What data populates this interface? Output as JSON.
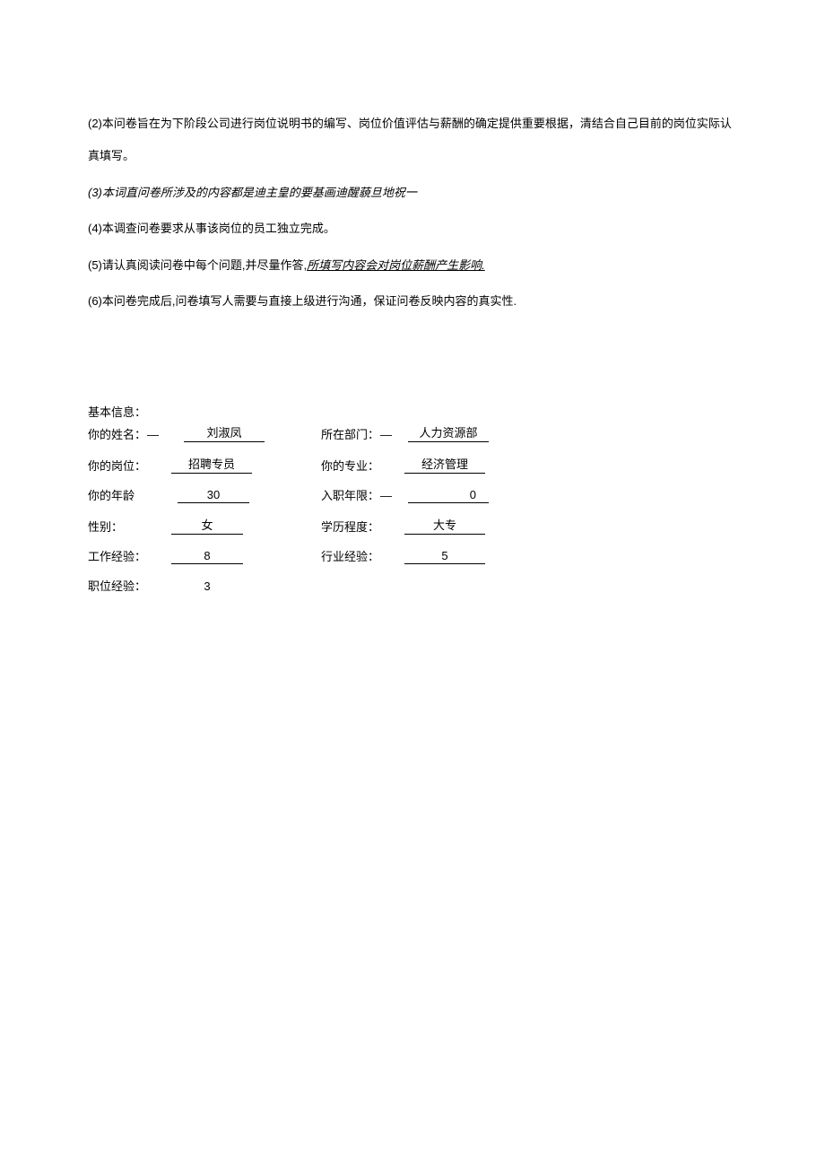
{
  "instructions": {
    "line2": "(2)本问卷旨在为下阶段公司进行岗位说明书的编写、岗位价值评估与薪酬的确定提供重要根据，清结合自己目前的岗位实际认真填写。",
    "line3": "(3)本词直问卷所涉及的内容都是迪主皇的要基画迪醒藐旦地祝一",
    "line4": "(4)本调查问卷要求从事该岗位的员工独立完成。",
    "line5a": "(5)请认真阅读问卷中每个问题,并尽量作答,",
    "line5b": "所填写内容会对岗位薪酬产生影响.",
    "line6": "(6)本问卷完成后,问卷填写人需要与直接上级进行沟通，保证问卷反映内容的真实性."
  },
  "basicInfo": {
    "title": "基本信息：",
    "labels": {
      "name": "你的姓名：",
      "dept": "所在部门：",
      "position": "你的岗位：",
      "major": "你的专业：",
      "age": "你的年龄",
      "tenure": "入职年限：",
      "gender": "性别：",
      "education": "学历程度：",
      "workExp": "工作经验：",
      "industryExp": "行业经验：",
      "positionExp": "职位经验："
    },
    "values": {
      "name": "刘淑凤",
      "dept": "人力资源部",
      "position": "招聘专员",
      "major": "经济管理",
      "age": "30",
      "tenure": "0",
      "gender": "女",
      "education": "大专",
      "workExp": "8",
      "industryExp": "5",
      "positionExp": "3"
    },
    "dash": "—"
  }
}
